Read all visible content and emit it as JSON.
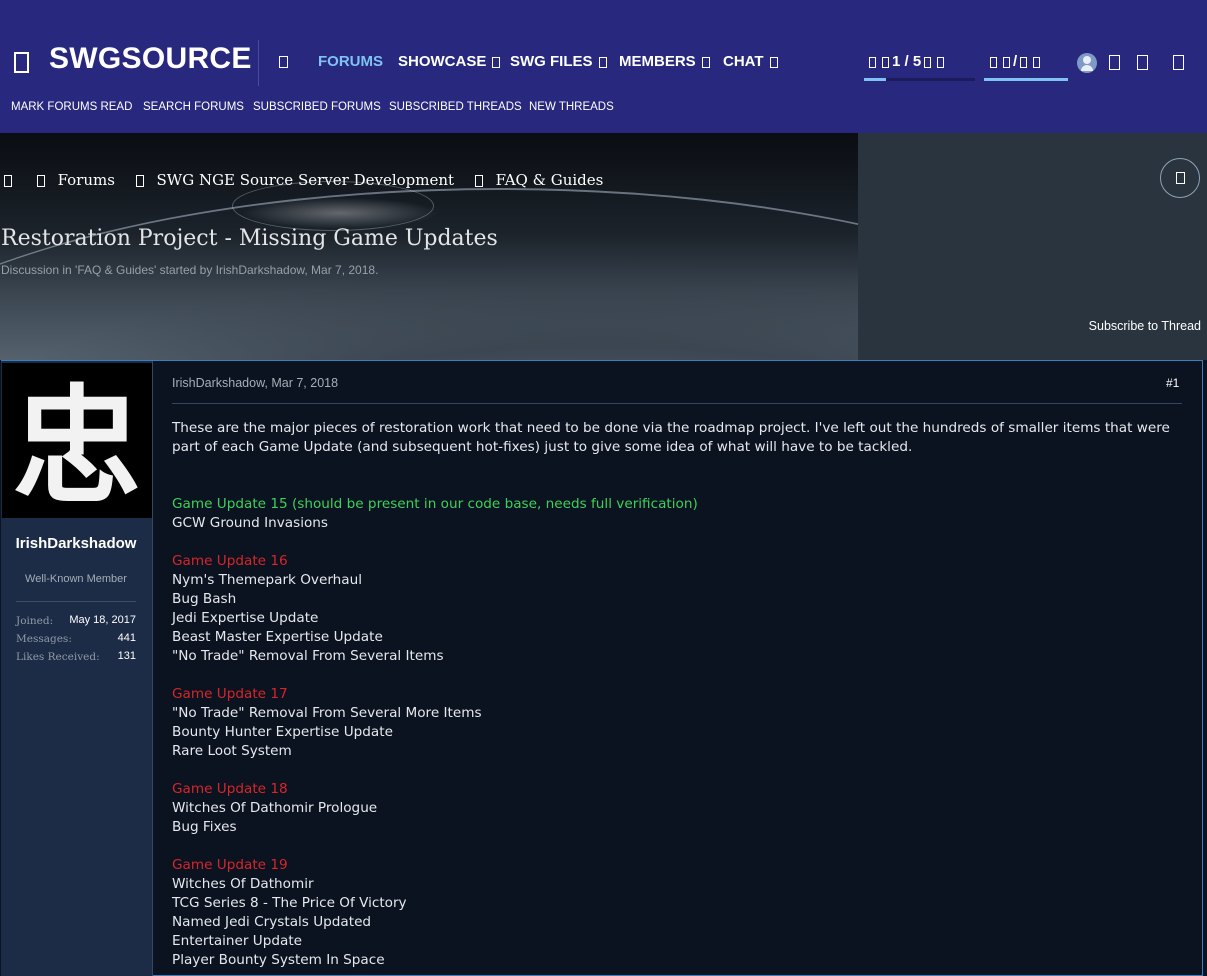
{
  "brand": {
    "name": "SWGSOURCE"
  },
  "nav": {
    "items": [
      {
        "label": "FORUMS"
      },
      {
        "label": "SHOWCASE"
      },
      {
        "label": "SWG FILES"
      },
      {
        "label": "MEMBERS"
      },
      {
        "label": "CHAT"
      }
    ],
    "alerts_count": "1 / 5",
    "conversations_count": "/"
  },
  "subnav": {
    "items": [
      {
        "label": "MARK FORUMS READ"
      },
      {
        "label": "SEARCH FORUMS"
      },
      {
        "label": "SUBSCRIBED FORUMS"
      },
      {
        "label": "SUBSCRIBED THREADS"
      },
      {
        "label": "NEW THREADS"
      }
    ]
  },
  "breadcrumb": {
    "items": [
      {
        "label": "Forums"
      },
      {
        "label": "SWG NGE Source Server Development"
      },
      {
        "label": "FAQ & Guides"
      }
    ]
  },
  "thread": {
    "title": "Restoration Project - Missing Game Updates",
    "meta": "Discussion in 'FAQ & Guides' started by IrishDarkshadow, Mar 7, 2018.",
    "subscribe_label": "Subscribe to Thread"
  },
  "user": {
    "avatar_glyph": "忠",
    "name": "IrishDarkshadow",
    "title": "Well-Known Member",
    "stats": [
      {
        "label": "Joined:",
        "value": "May 18, 2017"
      },
      {
        "label": "Messages:",
        "value": "441"
      },
      {
        "label": "Likes Received:",
        "value": "131"
      }
    ]
  },
  "post": {
    "meta": "IrishDarkshadow, Mar 7, 2018",
    "number": "#1",
    "intro": "These are the major pieces of restoration work that need to be done via the roadmap project. I've left out the hundreds of smaller items that were part of each Game Update (and subsequent hot-fixes) just to give some idea of what will have to be tackled.",
    "sections": [
      {
        "heading": "Game Update 15 (should be present in our code base, needs full verification)",
        "items": [
          "GCW Ground Invasions"
        ]
      },
      {
        "heading": "Game Update 16",
        "items": [
          "Nym's Themepark Overhaul",
          "Bug Bash",
          "Jedi Expertise Update",
          "Beast Master Expertise Update",
          "\"No Trade\" Removal From Several Items"
        ]
      },
      {
        "heading": "Game Update 17",
        "items": [
          "\"No Trade\" Removal From Several More Items",
          "Bounty Hunter Expertise Update",
          "Rare Loot System"
        ]
      },
      {
        "heading": "Game Update 18",
        "items": [
          "Witches Of Dathomir Prologue",
          "Bug Fixes"
        ]
      },
      {
        "heading": "Game Update 19",
        "items": [
          "Witches Of Dathomir",
          "TCG Series 8 - The Price Of Victory",
          "Named Jedi Crystals Updated",
          "Entertainer Update",
          "Player Bounty System In Space"
        ]
      }
    ]
  },
  "colors": {
    "nav_bg": "#28287f",
    "nav_active": "#7fc3f2",
    "heading_verified": "#3dd15a",
    "heading_missing": "#d6262a",
    "sidebar_bg": "#1d2c46",
    "post_border": "#3c7fc0"
  },
  "icons": [
    "logo-icon",
    "home-icon",
    "chevron-down-icon",
    "bell-icon",
    "mail-icon",
    "user-icon",
    "search-icon",
    "bookmark-icon",
    "menu-icon",
    "folder-icon",
    "plus-icon"
  ]
}
